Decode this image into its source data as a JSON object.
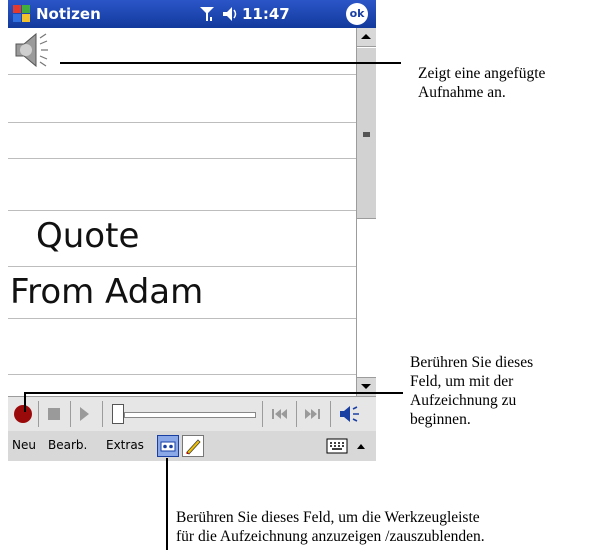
{
  "titlebar": {
    "title": "Notizen",
    "time": "11:47",
    "ok_label": "ok"
  },
  "note": {
    "handwriting_line_1": "Quote",
    "handwriting_line_2": "From Adam"
  },
  "menubar": {
    "items": [
      "Neu",
      "Bearb.",
      "Extras"
    ]
  },
  "callouts": {
    "recording_indicator": [
      "Zeigt eine angefügte",
      "Aufnahme an."
    ],
    "record_button": [
      "Berühren Sie dieses",
      "Feld, um mit der",
      "Aufzeichnung zu",
      "beginnen."
    ],
    "toolbar_toggle": [
      "Berühren Sie dieses Feld, um die Werkzeugleiste",
      "für die Aufzeichnung anzuzeigen /zauszublenden."
    ]
  },
  "colors": {
    "titlebar": "#1a3fa3",
    "record": "#9b0a0a"
  }
}
